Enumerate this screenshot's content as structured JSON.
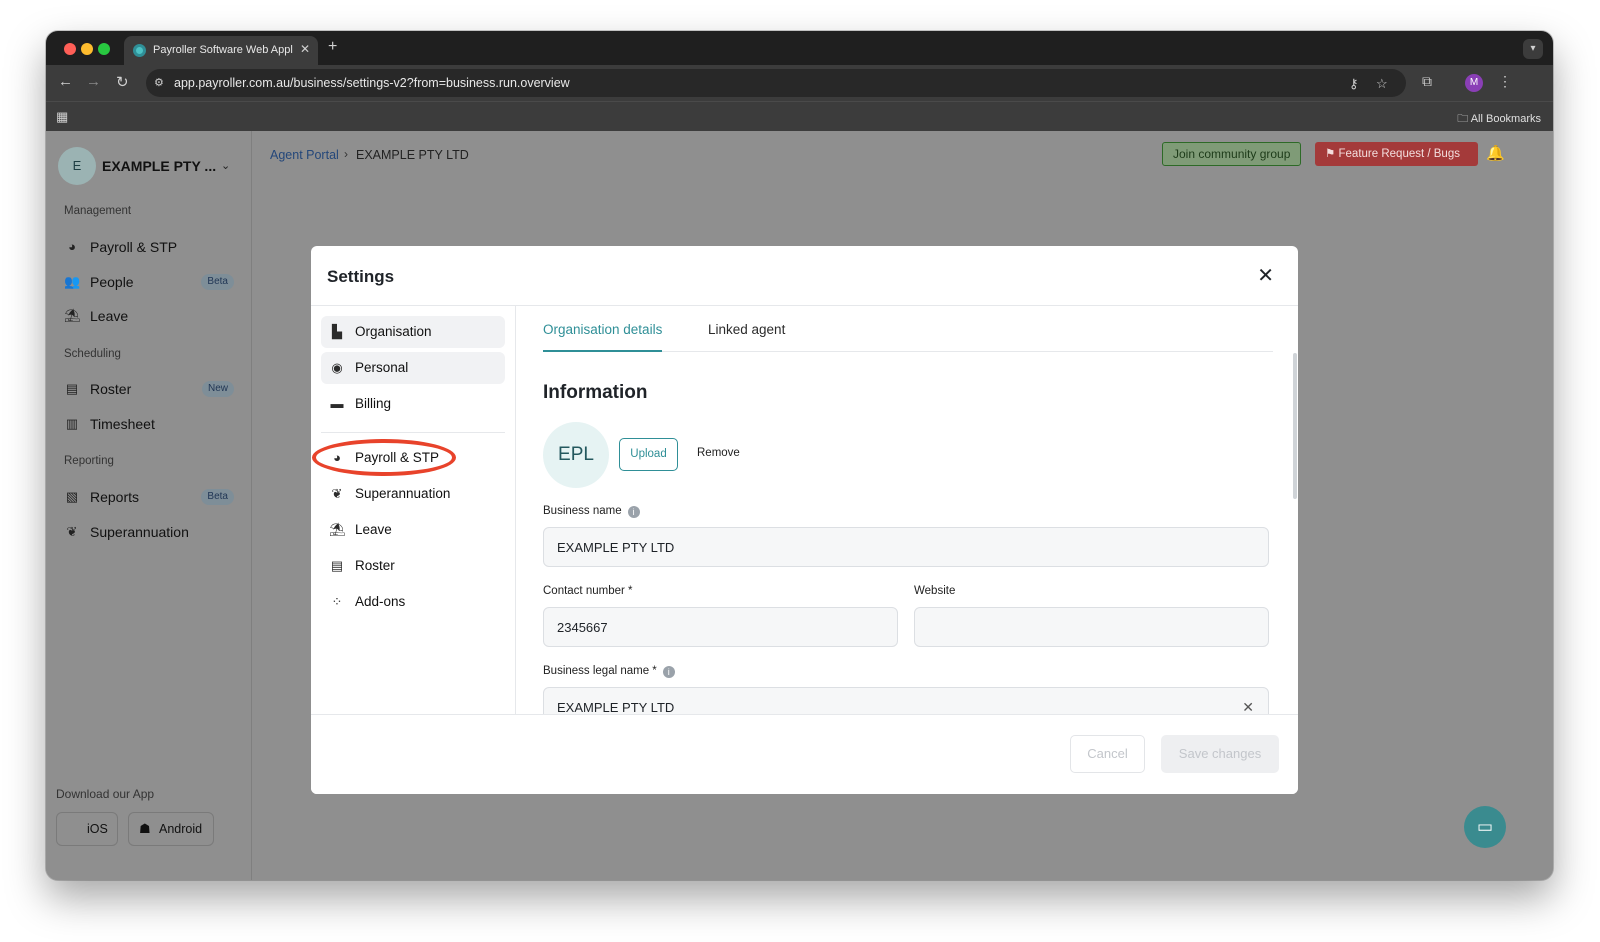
{
  "browser": {
    "tab_title": "Payroller Software Web Appli",
    "url": "app.payroller.com.au/business/settings-v2?from=business.run.overview",
    "bookmarks_label": "All Bookmarks",
    "profile_initial": "M"
  },
  "sidebar": {
    "business_initial": "E",
    "business_name": "EXAMPLE PTY ...",
    "sections": {
      "management": "Management",
      "scheduling": "Scheduling",
      "reporting": "Reporting"
    },
    "items": {
      "payroll": "Payroll & STP",
      "people": "People",
      "people_badge": "Beta",
      "leave": "Leave",
      "roster": "Roster",
      "roster_badge": "New",
      "timesheet": "Timesheet",
      "reports": "Reports",
      "reports_badge": "Beta",
      "superannuation": "Superannuation"
    },
    "download_title": "Download our App",
    "ios": "iOS",
    "android": "Android"
  },
  "header": {
    "breadcrumb_root": "Agent Portal",
    "breadcrumb_current": "EXAMPLE PTY LTD",
    "community_button": "Join community group",
    "feature_button": "Feature Request / Bugs"
  },
  "modal": {
    "title": "Settings",
    "nav": {
      "organisation": "Organisation",
      "personal": "Personal",
      "billing": "Billing",
      "payroll": "Payroll & STP",
      "superannuation": "Superannuation",
      "leave": "Leave",
      "roster": "Roster",
      "addons": "Add-ons"
    },
    "tabs": {
      "org_details": "Organisation details",
      "linked_agent": "Linked agent"
    },
    "info_title": "Information",
    "logo_initials": "EPL",
    "upload": "Upload",
    "remove": "Remove",
    "fields": {
      "business_name_label": "Business name",
      "business_name_value": "EXAMPLE PTY LTD",
      "contact_label": "Contact number *",
      "contact_value": "2345667",
      "website_label": "Website",
      "website_value": "",
      "legal_name_label": "Business legal name *",
      "legal_name_value": "EXAMPLE PTY LTD"
    },
    "cancel": "Cancel",
    "save": "Save changes"
  },
  "colors": {
    "accent": "#2f8f97",
    "highlight": "#e8432b",
    "feature_button": "#a43a3a"
  }
}
